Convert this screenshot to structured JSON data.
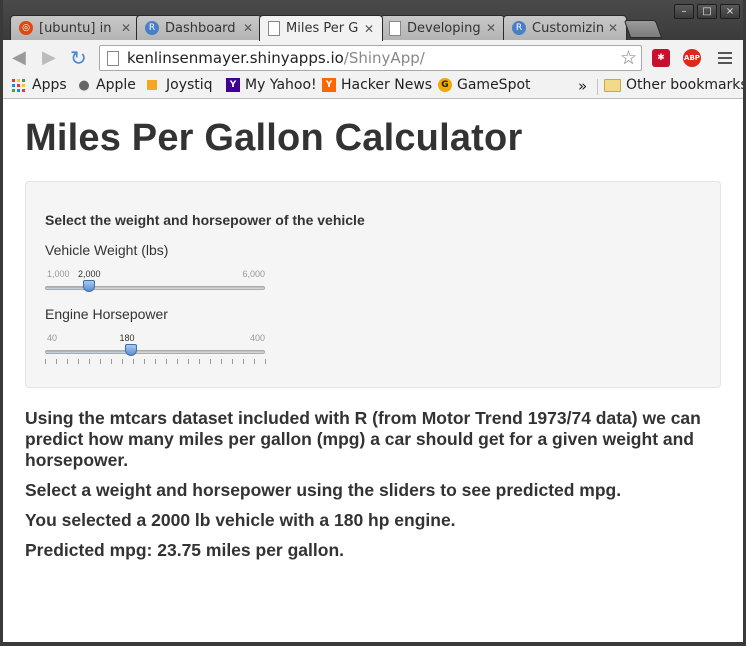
{
  "tabs": [
    {
      "label": "[ubuntu] in",
      "icon": "ubuntu-icon",
      "color": "#dd4814"
    },
    {
      "label": "Dashboard",
      "icon": "r-logo-icon",
      "color": "#4a7ec7"
    },
    {
      "label": "Miles Per G",
      "icon": "page-icon",
      "color": "#ffffff"
    },
    {
      "label": "Developing",
      "icon": "page-icon",
      "color": "#ffffff"
    },
    {
      "label": "Customizin",
      "icon": "r-logo-icon",
      "color": "#4a7ec7"
    }
  ],
  "window_controls": {
    "minimize": "–",
    "maximize": "□",
    "close": "×"
  },
  "omnibox": {
    "host": "kenlinsenmayer.shinyapps.io",
    "path": "/ShinyApp/"
  },
  "extensions": [
    {
      "name": "lastpass-icon",
      "label": "✱",
      "color": "#c8102e"
    },
    {
      "name": "adblock-plus-icon",
      "label": "ABP",
      "color": "#e1251b"
    }
  ],
  "bookmarks": {
    "items": [
      {
        "label": "Apps",
        "icon": "apps-icon"
      },
      {
        "label": "Apple",
        "icon": "apple-icon"
      },
      {
        "label": "Joystiq",
        "icon": "joystiq-icon"
      },
      {
        "label": "My Yahoo!",
        "icon": "yahoo-icon"
      },
      {
        "label": "Hacker News",
        "icon": "hacker-news-icon"
      },
      {
        "label": "GameSpot",
        "icon": "gamespot-icon"
      }
    ],
    "overflow": "»",
    "other": "Other bookmarks"
  },
  "page": {
    "title": "Miles Per Gallon Calculator",
    "panel_heading": "Select the weight and horsepower of the vehicle",
    "weight_slider": {
      "label": "Vehicle Weight (lbs)",
      "min": "1,000",
      "max": "6,000",
      "value": "2,000",
      "value_num": 2000,
      "min_num": 1000,
      "max_num": 6000
    },
    "hp_slider": {
      "label": "Engine Horsepower",
      "min": "40",
      "max": "400",
      "value": "180",
      "value_num": 180,
      "min_num": 40,
      "max_num": 400
    },
    "intro": "Using the mtcars dataset included with R (from Motor Trend 1973/74 data) we can predict how many miles per gallon (mpg) a car should get for a given weight and horsepower.",
    "instructions": "Select a weight and horsepower using the sliders to see predicted mpg.",
    "selection": "You selected a 2000 lb vehicle with a 180 hp engine.",
    "result": "Predicted mpg: 23.75 miles per gallon."
  }
}
